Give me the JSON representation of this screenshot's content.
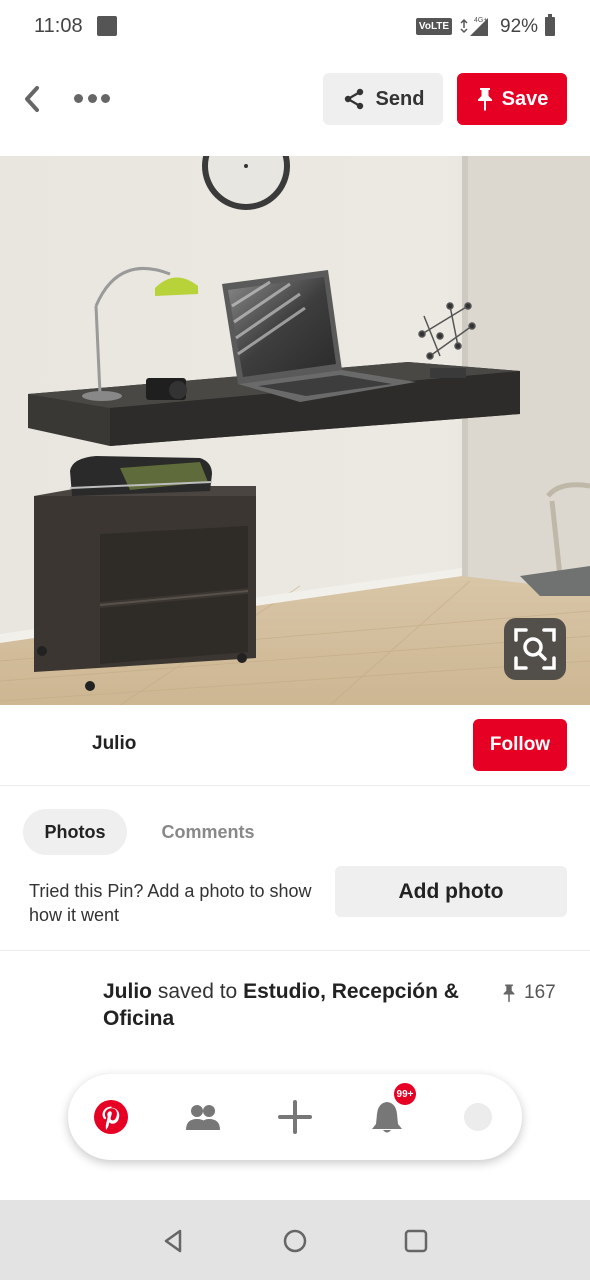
{
  "status_bar": {
    "time": "11:08",
    "volte": "VoLTE",
    "network": "4G+",
    "battery": "92%"
  },
  "top_bar": {
    "back_icon": "chevron-left-icon",
    "more_icon": "more-horizontal-icon",
    "send_label": "Send",
    "save_label": "Save"
  },
  "pin": {
    "lens_icon": "visual-search-icon"
  },
  "creator": {
    "name": "Julio",
    "follow_label": "Follow"
  },
  "tabs": [
    {
      "label": "Photos",
      "active": true
    },
    {
      "label": "Comments",
      "active": false
    }
  ],
  "try_it": {
    "prompt": "Tried this Pin? Add a photo to show how it went",
    "button": "Add photo"
  },
  "saved_info": {
    "user": "Julio",
    "verb": " saved to ",
    "board": "Estudio, Recepción & Oficina",
    "pin_count": "167"
  },
  "bottom_nav": {
    "items": [
      "pinterest-logo-icon",
      "following-icon",
      "create-plus-icon",
      "notifications-bell-icon",
      "profile-avatar"
    ],
    "notification_badge": "99+"
  },
  "colors": {
    "brand_red": "#e60023",
    "button_gray": "#efefef"
  }
}
